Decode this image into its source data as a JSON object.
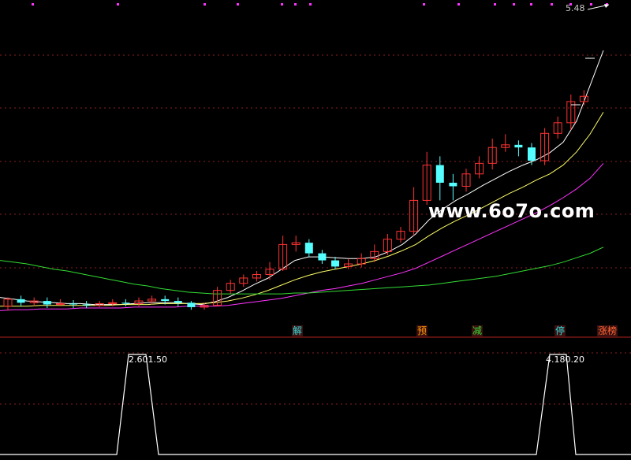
{
  "chart_data": [
    {
      "type": "candlestick",
      "title": "",
      "price_label": "5.48",
      "ylim": [
        0,
        6
      ],
      "candles": [
        [
          3.1,
          3.18,
          3.2,
          3.05
        ],
        [
          3.18,
          3.14,
          3.22,
          3.1
        ],
        [
          3.14,
          3.16,
          3.2,
          3.1
        ],
        [
          3.16,
          3.12,
          3.2,
          3.08
        ],
        [
          3.12,
          3.13,
          3.18,
          3.1
        ],
        [
          3.13,
          3.12,
          3.17,
          3.08
        ],
        [
          3.12,
          3.11,
          3.16,
          3.08
        ],
        [
          3.11,
          3.13,
          3.16,
          3.09
        ],
        [
          3.13,
          3.14,
          3.18,
          3.1
        ],
        [
          3.14,
          3.13,
          3.18,
          3.1
        ],
        [
          3.13,
          3.16,
          3.2,
          3.1
        ],
        [
          3.16,
          3.18,
          3.22,
          3.12
        ],
        [
          3.18,
          3.16,
          3.22,
          3.12
        ],
        [
          3.16,
          3.14,
          3.2,
          3.1
        ],
        [
          3.14,
          3.09,
          3.16,
          3.06
        ],
        [
          3.09,
          3.11,
          3.14,
          3.06
        ],
        [
          3.11,
          3.28,
          3.32,
          3.1
        ],
        [
          3.28,
          3.36,
          3.4,
          3.24
        ],
        [
          3.36,
          3.42,
          3.46,
          3.32
        ],
        [
          3.42,
          3.46,
          3.5,
          3.38
        ],
        [
          3.46,
          3.52,
          3.6,
          3.4
        ],
        [
          3.52,
          3.8,
          3.9,
          3.5
        ],
        [
          3.8,
          3.82,
          3.9,
          3.72
        ],
        [
          3.82,
          3.7,
          3.86,
          3.66
        ],
        [
          3.7,
          3.62,
          3.74,
          3.58
        ],
        [
          3.62,
          3.55,
          3.66,
          3.52
        ],
        [
          3.55,
          3.58,
          3.64,
          3.52
        ],
        [
          3.58,
          3.64,
          3.7,
          3.54
        ],
        [
          3.64,
          3.72,
          3.8,
          3.6
        ],
        [
          3.72,
          3.86,
          3.92,
          3.68
        ],
        [
          3.86,
          3.95,
          4.0,
          3.82
        ],
        [
          3.95,
          4.3,
          4.45,
          3.9
        ],
        [
          4.3,
          4.7,
          4.85,
          4.25
        ],
        [
          4.7,
          4.5,
          4.8,
          4.3
        ],
        [
          4.5,
          4.46,
          4.6,
          4.3
        ],
        [
          4.46,
          4.6,
          4.66,
          4.4
        ],
        [
          4.6,
          4.72,
          4.8,
          4.55
        ],
        [
          4.72,
          4.9,
          5.0,
          4.65
        ],
        [
          4.9,
          4.93,
          5.05,
          4.85
        ],
        [
          4.93,
          4.9,
          4.98,
          4.8
        ],
        [
          4.9,
          4.75,
          4.95,
          4.7
        ],
        [
          4.75,
          5.06,
          5.12,
          4.7
        ],
        [
          5.06,
          5.18,
          5.25,
          5.0
        ],
        [
          5.18,
          5.42,
          5.5,
          5.1
        ],
        [
          5.42,
          5.48,
          5.55,
          5.38
        ]
      ],
      "series": [
        {
          "color": "#ffffff",
          "values": [
            3.2,
            3.18,
            3.16,
            3.15,
            3.14,
            3.13,
            3.13,
            3.12,
            3.12,
            3.12,
            3.13,
            3.14,
            3.14,
            3.14,
            3.13,
            3.12,
            3.15,
            3.2,
            3.27,
            3.35,
            3.42,
            3.52,
            3.62,
            3.66,
            3.66,
            3.65,
            3.64,
            3.64,
            3.66,
            3.72,
            3.8,
            3.92,
            4.08,
            4.2,
            4.3,
            4.38,
            4.47,
            4.55,
            4.63,
            4.7,
            4.76,
            4.84,
            4.96,
            5.2,
            5.6,
            6.0
          ]
        },
        {
          "color": "#ffff66",
          "values": [
            3.1,
            3.1,
            3.1,
            3.11,
            3.11,
            3.11,
            3.11,
            3.11,
            3.11,
            3.12,
            3.12,
            3.12,
            3.13,
            3.13,
            3.13,
            3.13,
            3.14,
            3.16,
            3.19,
            3.23,
            3.28,
            3.34,
            3.4,
            3.45,
            3.49,
            3.52,
            3.55,
            3.58,
            3.62,
            3.67,
            3.73,
            3.8,
            3.9,
            3.99,
            4.07,
            4.14,
            4.22,
            4.3,
            4.38,
            4.45,
            4.53,
            4.6,
            4.7,
            4.85,
            5.05,
            5.3
          ]
        },
        {
          "color": "#ff33ff",
          "values": [
            3.05,
            3.06,
            3.06,
            3.07,
            3.07,
            3.07,
            3.08,
            3.08,
            3.08,
            3.08,
            3.09,
            3.09,
            3.09,
            3.09,
            3.1,
            3.1,
            3.1,
            3.11,
            3.13,
            3.15,
            3.17,
            3.19,
            3.22,
            3.25,
            3.28,
            3.3,
            3.33,
            3.36,
            3.4,
            3.44,
            3.48,
            3.53,
            3.6,
            3.67,
            3.74,
            3.81,
            3.88,
            3.95,
            4.02,
            4.09,
            4.16,
            4.24,
            4.33,
            4.43,
            4.55,
            4.72
          ]
        },
        {
          "color": "#33dd33",
          "values": [
            3.62,
            3.6,
            3.58,
            3.55,
            3.52,
            3.5,
            3.47,
            3.44,
            3.41,
            3.38,
            3.35,
            3.33,
            3.3,
            3.28,
            3.26,
            3.25,
            3.24,
            3.24,
            3.24,
            3.24,
            3.24,
            3.24,
            3.25,
            3.25,
            3.26,
            3.27,
            3.28,
            3.29,
            3.3,
            3.31,
            3.32,
            3.33,
            3.34,
            3.36,
            3.38,
            3.4,
            3.42,
            3.44,
            3.47,
            3.5,
            3.53,
            3.56,
            3.6,
            3.65,
            3.7,
            3.77
          ]
        }
      ],
      "signals": [
        {
          "label": "解",
          "color": "#33dddd",
          "index": 22
        },
        {
          "label": "预",
          "color": "#ff9900",
          "index": 32
        },
        {
          "label": "减",
          "color": "#33dd33",
          "index": 37
        },
        {
          "label": "停",
          "color": "#33dddd",
          "index": 43
        },
        {
          "label": "涨榜",
          "color": "#ff6633",
          "index": 46
        }
      ],
      "watermark": "www.6o7o.com"
    },
    {
      "type": "line",
      "title": "",
      "ylim": [
        0,
        5
      ],
      "values_labels": [
        "2.60",
        "1.50",
        "4.18",
        "0.20"
      ],
      "x": [
        0,
        148,
        163,
        185,
        201,
        680,
        697,
        718,
        730,
        800
      ],
      "y": [
        0,
        0,
        5,
        5,
        0,
        0,
        5,
        5,
        0,
        0
      ]
    }
  ]
}
